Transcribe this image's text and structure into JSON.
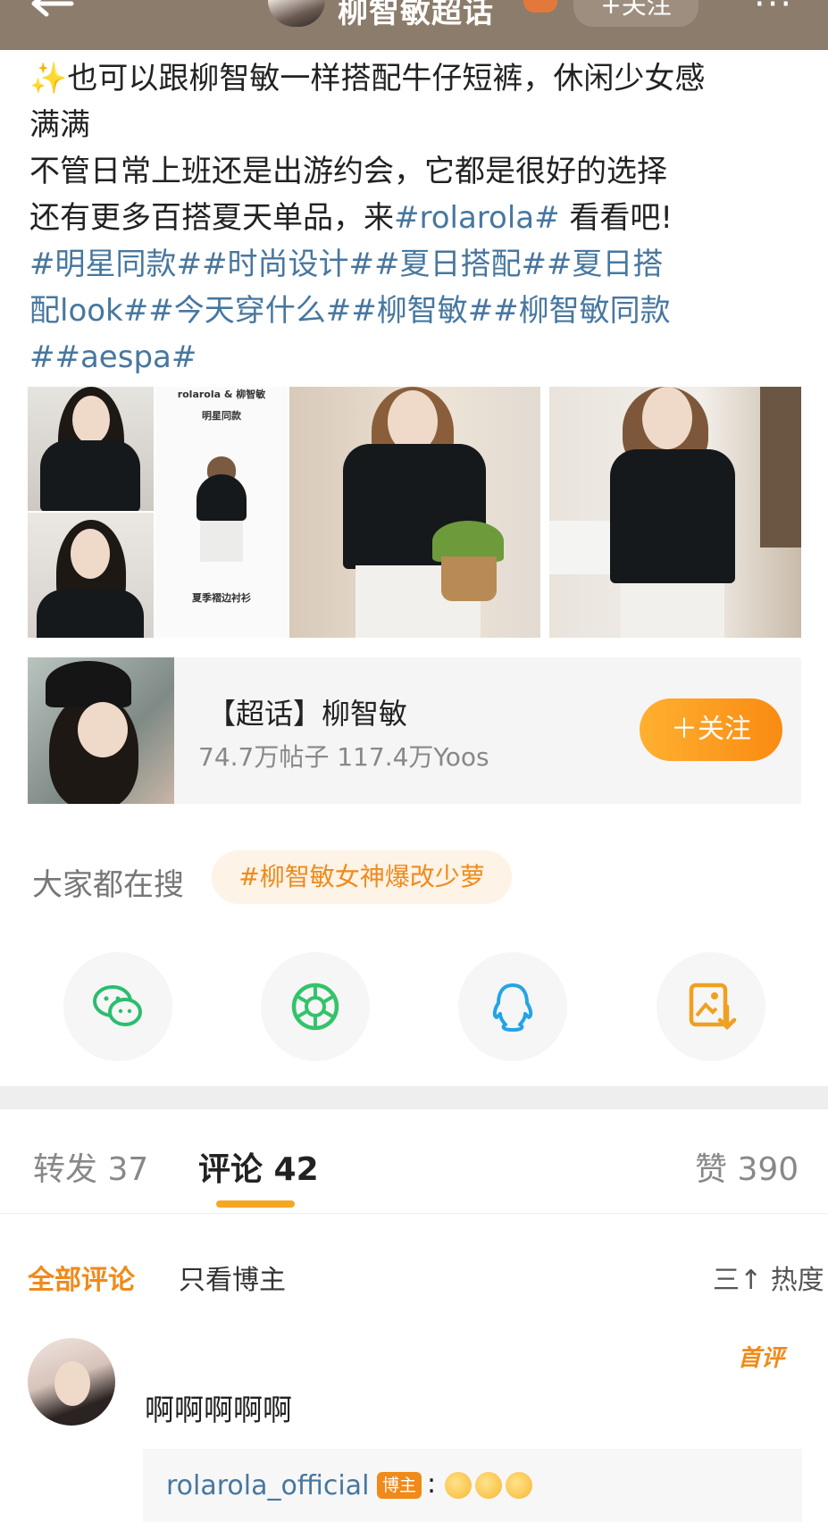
{
  "header": {
    "title": "柳智敏超话",
    "follow_label": "+关注",
    "more": "···",
    "back": "←"
  },
  "post": {
    "sparkle": "✨",
    "lines": [
      "也可以跟柳智敏一样搭配牛仔短裤，休闲少女感",
      "满满",
      "不管日常上班还是出游约会，它都是很好的选择"
    ],
    "line4_prefix": "还有更多百搭夏天单品，来",
    "line4_link": "#rolarola#",
    "line4_suffix": " 看看吧!",
    "hashtag_lines": [
      "#明星同款##时尚设计##夏日搭配##夏日搭",
      "配look##今天穿什么##柳智敏##柳智敏同款",
      "##aespa#"
    ]
  },
  "images": {
    "product_header": "rolarola & 柳智敏",
    "product_caption1": "明星同款",
    "product_caption2": "夏季褶边衬衫"
  },
  "topic": {
    "title": "【超话】柳智敏",
    "stats": "74.7万帖子 117.4万Yoos",
    "follow_label": "＋关注"
  },
  "search": {
    "label": "大家都在搜",
    "chip": "#柳智敏女神爆改少萝"
  },
  "share": {
    "icons": [
      "wechat-icon",
      "moments-icon",
      "qq-icon",
      "save-image-icon"
    ],
    "colors": {
      "wechat": "#2bbd6e",
      "moments": "#34c36b",
      "qq": "#23a4e6",
      "save": "#f0a020"
    }
  },
  "tabs": {
    "repost": "转发 37",
    "comments": "评论 42",
    "likes": "赞 390"
  },
  "filters": {
    "all": "全部评论",
    "owner_only": "只看博主",
    "sort": "热度",
    "sort_icon": "三↑"
  },
  "comment": {
    "first_badge": "首评",
    "text": "啊啊啊啊啊",
    "reply_user": "rolarola_official",
    "reply_badge": "博主",
    "reply_colon": ":"
  },
  "accent": "#f08a1a",
  "link_color": "#47779f"
}
